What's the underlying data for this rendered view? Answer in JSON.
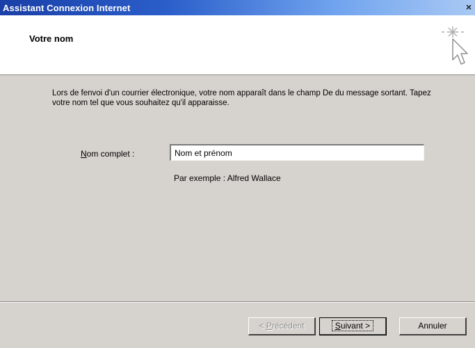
{
  "window": {
    "title": "Assistant Connexion Internet",
    "close_glyph": "×"
  },
  "header": {
    "heading": "Votre nom",
    "icon": "wizard-sparkle-cursor-icon"
  },
  "content": {
    "intro": "Lors de fenvoi d'un courrier électronique, votre nom apparaît dans le champ De du message sortant. Tapez votre nom tel que vous souhaitez qu'il apparaisse.",
    "field_label_accesskey": "N",
    "field_label_rest": "om complet :",
    "name_value": "Nom et prénom",
    "example": "Par exemple : Alfred Wallace"
  },
  "buttons": {
    "previous_accesskey": "P",
    "previous_pre": "< ",
    "previous_rest": "récédent",
    "next_accesskey": "S",
    "next_rest": "uivant >",
    "cancel": "Annuler"
  },
  "colors": {
    "dialog_bg": "#d6d3ce",
    "titlebar_start": "#1a3fa8",
    "titlebar_end": "#a9c9f4",
    "header_bg": "#ffffff"
  }
}
